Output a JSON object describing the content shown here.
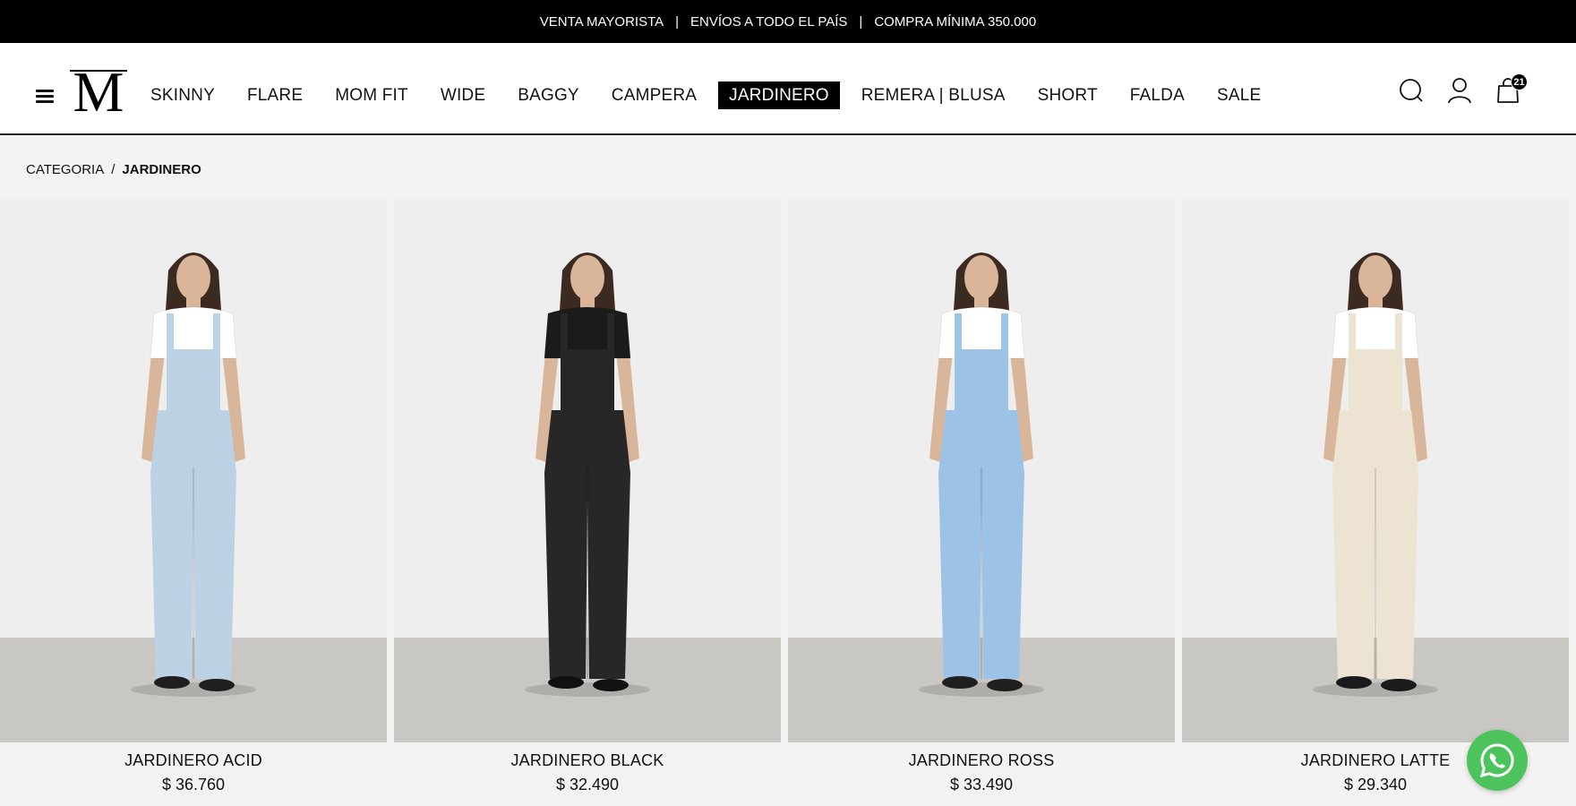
{
  "announcement": {
    "items": [
      "VENTA MAYORISTA",
      "ENVÍOS A TODO EL PAÍS",
      "COMPRA MÍNIMA 350.000"
    ],
    "separator": "|"
  },
  "header": {
    "logo_text": "M",
    "nav": [
      {
        "label": "SKINNY",
        "active": false
      },
      {
        "label": "FLARE",
        "active": false
      },
      {
        "label": "MOM FIT",
        "active": false
      },
      {
        "label": "WIDE",
        "active": false
      },
      {
        "label": "BAGGY",
        "active": false
      },
      {
        "label": "CAMPERA",
        "active": false
      },
      {
        "label": "JARDINERO",
        "active": true
      },
      {
        "label": "REMERA | BLUSA",
        "active": false
      },
      {
        "label": "SHORT",
        "active": false
      },
      {
        "label": "FALDA",
        "active": false
      },
      {
        "label": "SALE",
        "active": false
      }
    ],
    "icons": [
      "menu-icon",
      "search-icon",
      "user-icon",
      "bag-icon"
    ],
    "cart_count": "21"
  },
  "breadcrumb": {
    "parent": "CATEGORIA",
    "separator": "/",
    "current": "JARDINERO"
  },
  "products": [
    {
      "name": "JARDINERO ACID",
      "price": "$ 36.760",
      "overall_color": "#bcd2e4",
      "top_color": "#ffffff",
      "shoe_color": "#1f1f1f"
    },
    {
      "name": "JARDINERO BLACK",
      "price": "$ 32.490",
      "overall_color": "#272727",
      "top_color": "#1b1b1b",
      "shoe_color": "#111111"
    },
    {
      "name": "JARDINERO ROSS",
      "price": "$ 33.490",
      "overall_color": "#9cc2e6",
      "top_color": "#ffffff",
      "shoe_color": "#1f1f1f"
    },
    {
      "name": "JARDINERO LATTE",
      "price": "$ 29.340",
      "overall_color": "#ece3d3",
      "top_color": "#ffffff",
      "shoe_color": "#1a1a1a"
    }
  ],
  "colors": {
    "announcement_bg": "#000000",
    "whatsapp": "#4cc35b",
    "studio_wall": "#eeeeee",
    "studio_floor": "#c9c7c3",
    "skin": "#d9b59a",
    "hair": "#3b2a20"
  },
  "floating": {
    "whatsapp_icon": "whatsapp-icon"
  }
}
